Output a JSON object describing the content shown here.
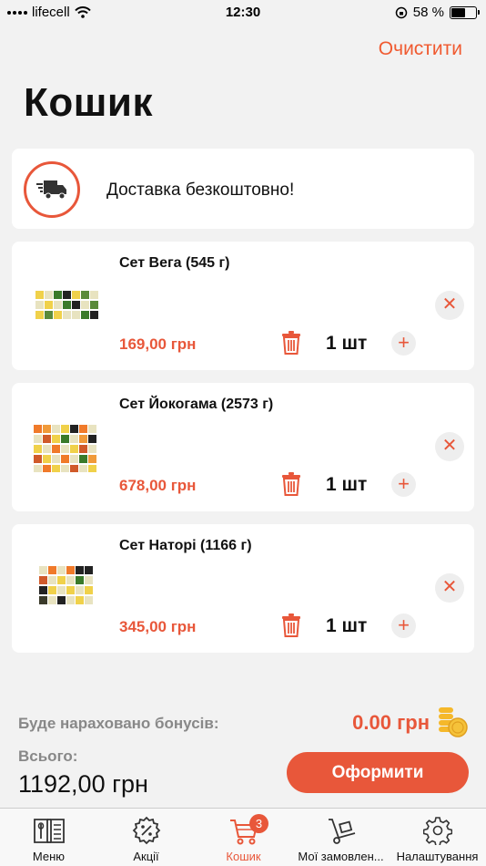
{
  "status": {
    "carrier": "lifecell",
    "time": "12:30",
    "battery": "58 %",
    "battery_level": 0.58
  },
  "header": {
    "clear_label": "Очистити",
    "title": "Кошик"
  },
  "delivery": {
    "text": "Доставка безкоштовно!"
  },
  "cart": {
    "items": [
      {
        "name": "Сет Вега (545 г)",
        "price": "169,00 грн",
        "quantity": "1 шт"
      },
      {
        "name": "Сет Йокогама (2573 г)",
        "price": "678,00 грн",
        "quantity": "1 шт"
      },
      {
        "name": "Сет Наторі (1166 г)",
        "price": "345,00 грн",
        "quantity": "1 шт"
      }
    ]
  },
  "summary": {
    "bonus_label": "Буде нараховано бонусів:",
    "bonus_value": "0.00 грн",
    "total_label": "Всього:",
    "total_value": "1192,00 грн",
    "checkout_label": "Оформити"
  },
  "tabbar": {
    "menu": "Меню",
    "promos": "Акції",
    "cart": "Кошик",
    "cart_badge": "3",
    "orders": "Мої замовлен...",
    "settings": "Налаштування"
  },
  "colors": {
    "accent": "#e8573a",
    "background": "#f2f2f2"
  }
}
